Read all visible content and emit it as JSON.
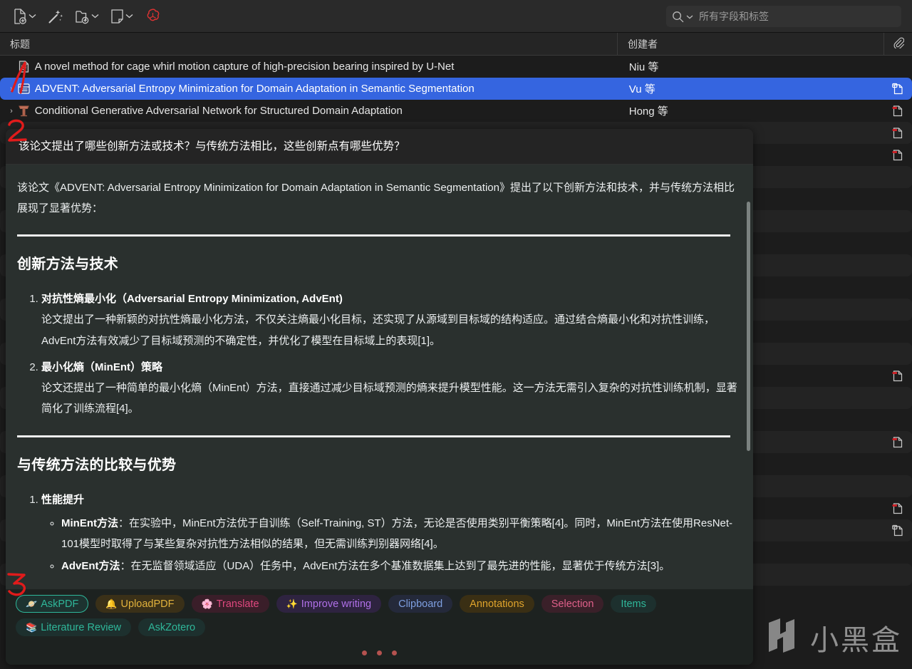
{
  "app": {
    "title": "Zotero",
    "theme_bg": "#1c1c1c",
    "accent": "#3565e0"
  },
  "toolbar": {
    "buttons": [
      {
        "name": "new-item-button",
        "icon": "new-document-icon",
        "has_caret": true
      },
      {
        "name": "add-by-identifier-button",
        "icon": "magic-wand-icon",
        "has_caret": false
      },
      {
        "name": "add-attachment-button",
        "icon": "add-attachment-icon",
        "has_caret": true
      },
      {
        "name": "new-note-button",
        "icon": "note-icon",
        "has_caret": true
      },
      {
        "name": "ai-assistant-button",
        "icon": "openai-logo-icon",
        "has_caret": false
      }
    ],
    "search": {
      "icon": "search-icon",
      "caret_icon": "chevron-down-icon",
      "value": "",
      "placeholder": "所有字段和标签"
    }
  },
  "table": {
    "columns": [
      {
        "key": "title",
        "label": "标题"
      },
      {
        "key": "creator",
        "label": "创建者"
      },
      {
        "key": "attachment",
        "label": "",
        "icon": "paperclip-icon"
      }
    ],
    "rows": [
      {
        "twisty": "",
        "icon": "document-icon",
        "title": "A novel method for cage whirl motion capture of high-precision bearing inspired by U-Net",
        "creator": "Niu 等",
        "attachment": "",
        "selected": false,
        "alt": false
      },
      {
        "twisty": "›",
        "icon": "conference-paper-icon",
        "title": "ADVENT: Adversarial Entropy Minimization for Domain Adaptation in Semantic Segmentation",
        "creator": "Vu 等",
        "attachment": "snapshot-icon",
        "selected": true,
        "alt": false
      },
      {
        "twisty": "›",
        "icon": "presentation-icon",
        "title": "Conditional Generative Adversarial Network for Structured Domain Adaptation",
        "creator": "Hong 等",
        "attachment": "pdf-icon",
        "selected": false,
        "alt": false
      },
      {
        "twisty": "",
        "icon": "",
        "title": "",
        "creator": "",
        "attachment": "pdf-icon",
        "selected": false,
        "alt": true
      },
      {
        "twisty": "",
        "icon": "",
        "title": "",
        "creator": "",
        "attachment": "pdf-icon",
        "selected": false,
        "alt": false
      },
      {
        "twisty": "",
        "icon": "",
        "title": "",
        "creator": "",
        "attachment": "",
        "selected": false,
        "alt": true
      },
      {
        "twisty": "",
        "icon": "",
        "title": "",
        "creator": "",
        "attachment": "",
        "selected": false,
        "alt": false
      },
      {
        "twisty": "",
        "icon": "",
        "title": "",
        "creator": "",
        "attachment": "",
        "selected": false,
        "alt": true
      },
      {
        "twisty": "",
        "icon": "",
        "title": "",
        "creator": "",
        "attachment": "",
        "selected": false,
        "alt": false
      },
      {
        "twisty": "",
        "icon": "",
        "title": "",
        "creator": "",
        "attachment": "",
        "selected": false,
        "alt": true
      },
      {
        "twisty": "",
        "icon": "",
        "title": "",
        "creator": "",
        "attachment": "",
        "selected": false,
        "alt": false
      },
      {
        "twisty": "",
        "icon": "",
        "title": "",
        "creator": "",
        "attachment": "",
        "selected": false,
        "alt": true
      },
      {
        "twisty": "",
        "icon": "",
        "title": "",
        "creator": "",
        "attachment": "",
        "selected": false,
        "alt": false
      },
      {
        "twisty": "",
        "icon": "",
        "title": "",
        "creator": "",
        "attachment": "",
        "selected": false,
        "alt": true
      },
      {
        "twisty": "",
        "icon": "",
        "title": "",
        "creator": "",
        "attachment": "pdf-icon",
        "selected": false,
        "alt": false
      },
      {
        "twisty": "",
        "icon": "",
        "title": "",
        "creator": "",
        "attachment": "",
        "selected": false,
        "alt": true
      },
      {
        "twisty": "",
        "icon": "",
        "title": "",
        "creator": "",
        "attachment": "",
        "selected": false,
        "alt": false
      },
      {
        "twisty": "",
        "icon": "",
        "title": "",
        "creator": "",
        "attachment": "pdf-icon",
        "selected": false,
        "alt": true
      },
      {
        "twisty": "",
        "icon": "",
        "title": "",
        "creator": "",
        "attachment": "",
        "selected": false,
        "alt": false
      },
      {
        "twisty": "",
        "icon": "",
        "title": "",
        "creator": "",
        "attachment": "",
        "selected": false,
        "alt": true
      },
      {
        "twisty": "",
        "icon": "",
        "title": "",
        "creator": "",
        "attachment": "pdf-icon",
        "selected": false,
        "alt": false
      },
      {
        "twisty": "",
        "icon": "",
        "title": "",
        "creator": "",
        "attachment": "snapshot-icon",
        "selected": false,
        "alt": true
      },
      {
        "twisty": "",
        "icon": "",
        "title": "",
        "creator": "",
        "attachment": "",
        "selected": false,
        "alt": false
      },
      {
        "twisty": "",
        "icon": "",
        "title": "",
        "creator": "",
        "attachment": "",
        "selected": false,
        "alt": true
      }
    ]
  },
  "chat": {
    "question": "该论文提出了哪些创新方法或技术？与传统方法相比，这些创新点有哪些优势？",
    "intro": "该论文《ADVENT: Adversarial Entropy Minimization for Domain Adaptation in Semantic Segmentation》提出了以下创新方法和技术，并与传统方法相比展现了显著优势：",
    "section1": {
      "heading": "创新方法与技术",
      "items": [
        {
          "head": "对抗性熵最小化（Adversarial Entropy Minimization, AdvEnt)",
          "text": "论文提出了一种新颖的对抗性熵最小化方法，不仅关注熵最小化目标，还实现了从源域到目标域的结构适应。通过结合熵最小化和对抗性训练，AdvEnt方法有效减少了目标域预测的不确定性，并优化了模型在目标域上的表现[1]。"
        },
        {
          "head": "最小化熵（MinEnt）策略",
          "text": "论文还提出了一种简单的最小化熵（MinEnt）方法，直接通过减少目标域预测的熵来提升模型性能。这一方法无需引入复杂的对抗性训练机制，显著简化了训练流程[4]。"
        }
      ]
    },
    "section2": {
      "heading": "与传统方法的比较与优势",
      "items": [
        {
          "head": "性能提升",
          "subitems": [
            {
              "label": "MinEnt方法",
              "text": "：在实验中，MinEnt方法优于自训练（Self-Training, ST）方法，无论是否使用类别平衡策略[4]。同时，MinEnt方法在使用ResNet-101模型时取得了与某些复杂对抗性方法相似的结果，但无需训练判别器网络[4]。"
            },
            {
              "label": "AdvEnt方法",
              "text": "：在无监督领域适应（UDA）任务中，AdvEnt方法在多个基准数据集上达到了最先进的性能，显著优于传统方法[3]。"
            }
          ]
        }
      ]
    },
    "actions": [
      {
        "name": "askpdf-chip",
        "icon": "🪐",
        "label": "AskPDF",
        "color": "#2fb79a",
        "bg": "#1d3330",
        "border": "#2fb79a"
      },
      {
        "name": "uploadpdf-chip",
        "icon": "🔔",
        "label": "UploadPDF",
        "color": "#e2b23c",
        "bg": "#3a3018",
        "border": "transparent"
      },
      {
        "name": "translate-chip",
        "icon": "🌸",
        "label": "Translate",
        "color": "#e0487f",
        "bg": "#3a1e29",
        "border": "transparent"
      },
      {
        "name": "improve-writing-chip",
        "icon": "✨",
        "label": "Improve writing",
        "color": "#b070e8",
        "bg": "#2e2340",
        "border": "transparent"
      },
      {
        "name": "clipboard-chip",
        "icon": "",
        "label": "Clipboard",
        "color": "#7e9fe0",
        "bg": "#24293a",
        "border": "transparent"
      },
      {
        "name": "annotations-chip",
        "icon": "",
        "label": "Annotations",
        "color": "#e0a42c",
        "bg": "#3a2f14",
        "border": "transparent"
      },
      {
        "name": "selection-chip",
        "icon": "",
        "label": "Selection",
        "color": "#e0608a",
        "bg": "#3a2029",
        "border": "transparent"
      },
      {
        "name": "items-chip",
        "icon": "",
        "label": "Items",
        "color": "#2fb79a",
        "bg": "#1d302e",
        "border": "transparent"
      },
      {
        "name": "literature-review-chip",
        "icon": "📚",
        "label": "Literature Review",
        "color": "#2fb79a",
        "bg": "#1d302e",
        "border": "transparent"
      },
      {
        "name": "askzotero-chip",
        "icon": "",
        "label": "AskZotero",
        "color": "#2fb79a",
        "bg": "#1d302e",
        "border": "transparent"
      }
    ],
    "pager_dots": 3
  },
  "annotations": [
    {
      "name": "red-mark-1",
      "label": "1"
    },
    {
      "name": "red-mark-2",
      "label": "2"
    },
    {
      "name": "red-mark-3",
      "label": "3"
    }
  ],
  "watermark": {
    "text": "小黑盒",
    "logo": "xiaoheihe-logo-icon"
  }
}
